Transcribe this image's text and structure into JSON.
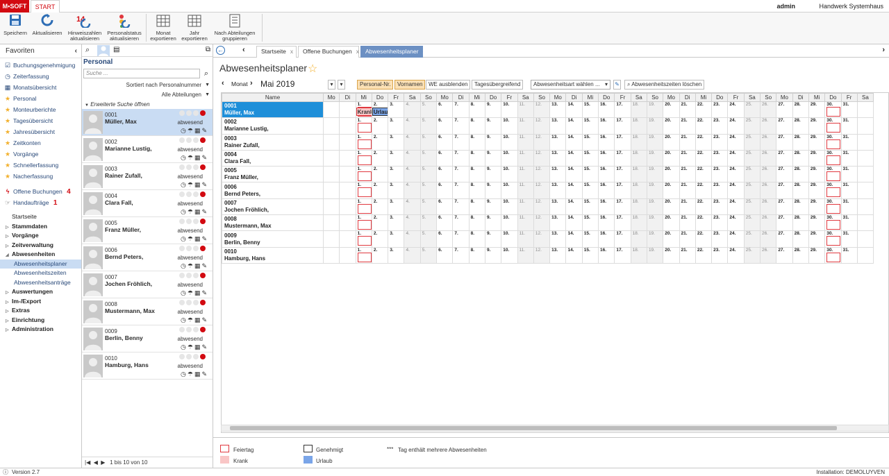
{
  "app": {
    "logo": "M•SOFT",
    "start_tab": "START",
    "user": "admin",
    "company": "Handwerk Systemhaus"
  },
  "ribbon": [
    {
      "label": "Speichern",
      "icon": "save-icon"
    },
    {
      "label": "Aktualisieren",
      "icon": "refresh-icon"
    },
    {
      "label": "Hinweiszahlen aktualisieren",
      "icon": "badge-refresh-icon",
      "badge": "14"
    },
    {
      "label": "Personalstatus aktualisieren",
      "icon": "status-refresh-icon"
    },
    {
      "label": "Monat exportieren",
      "icon": "calendar-export-icon"
    },
    {
      "label": "Jahr exportieren",
      "icon": "calendar-export-icon"
    },
    {
      "label": "Nach Abteilungen gruppieren",
      "icon": "group-list-icon"
    }
  ],
  "favorites": {
    "title": "Favoriten",
    "items": [
      {
        "label": "Buchungsgenehmigung",
        "icon": "approval-icon"
      },
      {
        "label": "Zeiterfassung",
        "icon": "clock-icon"
      },
      {
        "label": "Monatsübersicht",
        "icon": "calendar-icon"
      },
      {
        "label": "Personal",
        "icon": "star-icon"
      },
      {
        "label": "Monteurberichte",
        "icon": "star-icon"
      },
      {
        "label": "Tagesübersicht",
        "icon": "star-icon"
      },
      {
        "label": "Jahresübersicht",
        "icon": "star-icon"
      },
      {
        "label": "Zeitkonten",
        "icon": "star-icon"
      },
      {
        "label": "Vorgänge",
        "icon": "star-icon"
      },
      {
        "label": "Schnellerfassung",
        "icon": "star-icon"
      },
      {
        "label": "Nacherfassung",
        "icon": "star-icon"
      }
    ],
    "offene": {
      "label": "Offene Buchungen",
      "count": "4"
    },
    "hand": {
      "label": "Handaufträge",
      "count": "1"
    }
  },
  "nav": [
    {
      "label": "Startseite",
      "type": "plain"
    },
    {
      "label": "Stammdaten",
      "type": "group"
    },
    {
      "label": "Vorgänge",
      "type": "group"
    },
    {
      "label": "Zeitverwaltung",
      "type": "group"
    },
    {
      "label": "Abwesenheiten",
      "type": "open"
    },
    {
      "label": "Abwesenheitsplaner",
      "type": "sub",
      "selected": true
    },
    {
      "label": "Abwesenheitszeiten",
      "type": "sub"
    },
    {
      "label": "Abwesenheitsanträge",
      "type": "sub"
    },
    {
      "label": "Auswertungen",
      "type": "group"
    },
    {
      "label": "Im-/Export",
      "type": "group"
    },
    {
      "label": "Extras",
      "type": "group"
    },
    {
      "label": "Einrichtung",
      "type": "group"
    },
    {
      "label": "Administration",
      "type": "group"
    }
  ],
  "personal": {
    "title": "Personal",
    "search_placeholder": "Suche ...",
    "sort": "Sortiert nach Personalnummer",
    "dept": "Alle Abteilungen",
    "adv": "Erweiterte Suche öffnen",
    "status_label": "abwesend",
    "pager": "1 bis 10 von 10",
    "people": [
      {
        "num": "0001",
        "name": "Müller, Max",
        "selected": true
      },
      {
        "num": "0002",
        "name": "Marianne Lustig,"
      },
      {
        "num": "0003",
        "name": "Rainer Zufall,"
      },
      {
        "num": "0004",
        "name": "Clara Fall,"
      },
      {
        "num": "0005",
        "name": "Franz Müller,"
      },
      {
        "num": "0006",
        "name": "Bernd Peters,"
      },
      {
        "num": "0007",
        "name": "Jochen Fröhlich,"
      },
      {
        "num": "0008",
        "name": "Mustermann, Max"
      },
      {
        "num": "0009",
        "name": "Berlin, Benny"
      },
      {
        "num": "0010",
        "name": "Hamburg, Hans"
      }
    ]
  },
  "tabs": [
    {
      "label": "Startseite",
      "active": false
    },
    {
      "label": "Offene Buchungen",
      "active": false
    },
    {
      "label": "Abwesenheitsplaner",
      "active": true
    }
  ],
  "tab_close": "x",
  "page": {
    "title": "Abwesenheitsplaner"
  },
  "controls": {
    "monat": "Monat",
    "month": "Mai 2019",
    "btn_personal": "Personal-Nr.",
    "btn_vorname": "Vornamen",
    "btn_we": "WE ausblenden",
    "btn_tag": "Tagesübergreifend",
    "select": "Abwesenheitsart wählen ...",
    "clear": "Abwesenheitszeiten löschen"
  },
  "grid": {
    "name_header": "Name",
    "weekdays": [
      "Mo",
      "Di",
      "Mi",
      "Do",
      "Fr",
      "Sa",
      "So",
      "Mo",
      "Di",
      "Mi",
      "Do",
      "Fr",
      "Sa",
      "So",
      "Mo",
      "Di",
      "Mi",
      "Do",
      "Fr",
      "Sa",
      "So",
      "Mo",
      "Di",
      "Mi",
      "Do",
      "Fr",
      "Sa",
      "So",
      "Mo",
      "Di",
      "Mi",
      "Do",
      "Fr",
      "Sa"
    ],
    "first_day_index": 2,
    "days_in_month": 31,
    "holidays": [
      1,
      30
    ],
    "entries": [
      {
        "row": 0,
        "day": 1,
        "type": "Krank"
      },
      {
        "row": 0,
        "day": 2,
        "type": "Urlaub"
      }
    ]
  },
  "legend": {
    "feiertag": "Feiertag",
    "krank": "Krank",
    "genehmigt": "Genehmigt",
    "urlaub": "Urlaub",
    "multi_mark": "***",
    "multi_text": "Tag enthält mehrere Abwesenheiten"
  },
  "colors": {
    "brand": "#d20a11",
    "accent": "#6c90c3",
    "selected_row": "#1e8fd9",
    "krank": "#f9c6c6",
    "urlaub": "#7aa5e8",
    "holiday": "#e0383e"
  },
  "status": {
    "version": "Version 2.7",
    "installation": "Installation: DEMOLUYVEN"
  }
}
